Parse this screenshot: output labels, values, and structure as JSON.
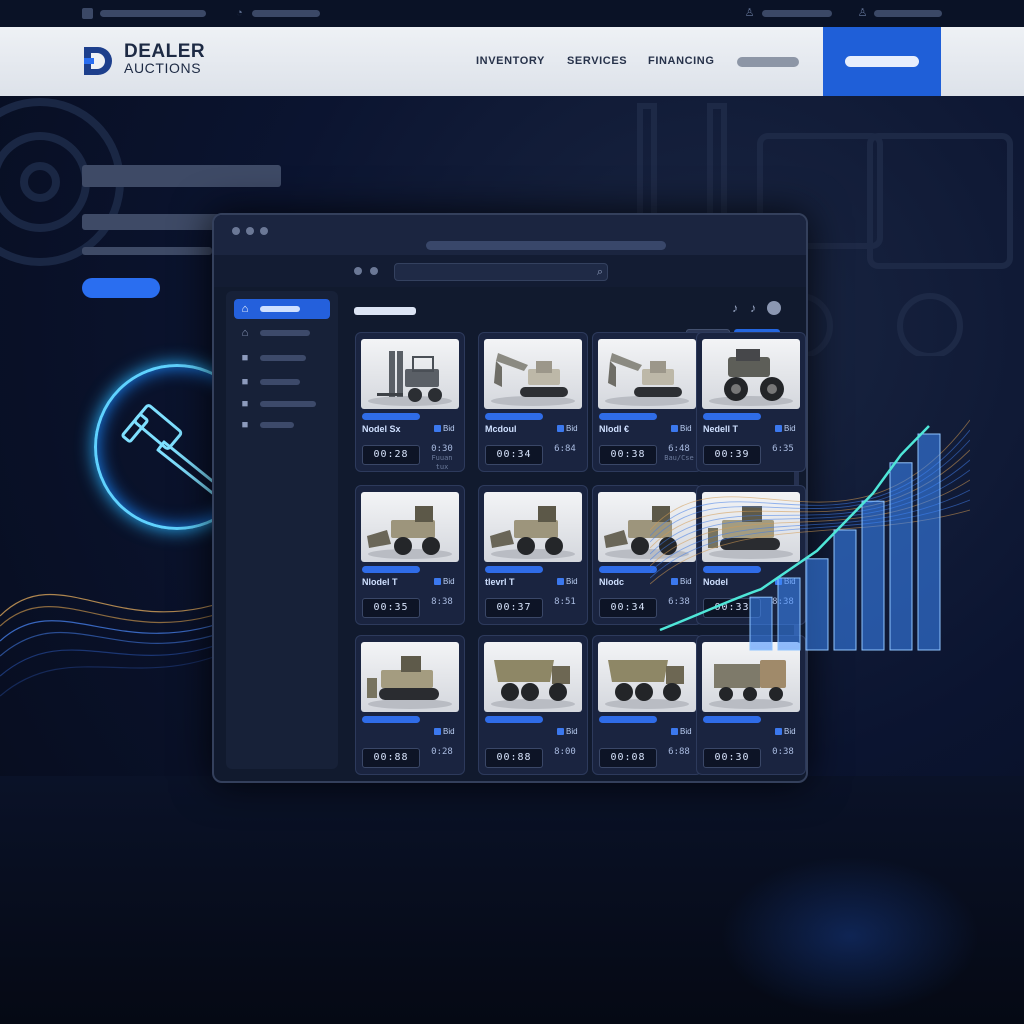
{
  "brand": {
    "name_line1": "DEALER",
    "name_line2": "AUCTIONS",
    "mark_color": "#1d3f8c",
    "accent": "#2a6ef0"
  },
  "utility_bar": {
    "icons": [
      "clock-icon",
      "user-icon",
      "person-icon"
    ]
  },
  "nav": {
    "links": [
      "INVENTORY",
      "SERVICES",
      "FINANCING"
    ]
  },
  "hero": {
    "icon": "gavel-icon"
  },
  "window": {
    "search_icon": "search-icon",
    "sidebar_icons": [
      "home-icon",
      "home-icon",
      "grid-icon",
      "grid-icon",
      "grid-icon",
      "grid-icon"
    ],
    "header_icons": [
      "bell-icon",
      "bell-icon",
      "avatar"
    ]
  },
  "listings": [
    {
      "name": "Nodel Sx",
      "bid": "Bid",
      "timer": "00:28",
      "price": "0:30",
      "price_sub": "Fuuan tux",
      "machine": "forklift"
    },
    {
      "name": "Mcdoul",
      "bid": "Bid",
      "timer": "00:34",
      "price": "6:84",
      "price_sub": "",
      "machine": "excavator"
    },
    {
      "name": "Nlodl €",
      "bid": "Bid",
      "timer": "00:38",
      "price": "6:48",
      "price_sub": "Bau/Cse",
      "machine": "excavator"
    },
    {
      "name": "Nedell T",
      "bid": "Bid",
      "timer": "00:39",
      "price": "6:35",
      "price_sub": "",
      "machine": "tractor"
    },
    {
      "name": "Nlodel T",
      "bid": "Bid",
      "timer": "00:35",
      "price": "8:38",
      "price_sub": "",
      "machine": "wheel-loader"
    },
    {
      "name": "tlevrl T",
      "bid": "Bid",
      "timer": "00:37",
      "price": "8:51",
      "price_sub": "",
      "machine": "wheel-loader"
    },
    {
      "name": "Nlodc",
      "bid": "Bid",
      "timer": "00:34",
      "price": "6:38",
      "price_sub": "",
      "machine": "wheel-loader"
    },
    {
      "name": "Nodel",
      "bid": "Bid",
      "timer": "00:33",
      "price": "8:38",
      "price_sub": "",
      "machine": "bulldozer"
    },
    {
      "name": "",
      "bid": "Bid",
      "timer": "00:88",
      "price": "0:28",
      "price_sub": "",
      "machine": "bulldozer"
    },
    {
      "name": "",
      "bid": "Bid",
      "timer": "00:88",
      "price": "8:00",
      "price_sub": "",
      "machine": "dump-truck"
    },
    {
      "name": "",
      "bid": "Bid",
      "timer": "00:08",
      "price": "6:88",
      "price_sub": "",
      "machine": "dump-truck"
    },
    {
      "name": "",
      "bid": "Bid",
      "timer": "00:30",
      "price": "0:38",
      "price_sub": "",
      "machine": "truck"
    }
  ],
  "growth_chart": {
    "bar_levels": [
      0.22,
      0.3,
      0.38,
      0.5,
      0.62,
      0.78,
      0.9
    ],
    "line_color": "#4fe6d8",
    "bar_color": "#3d8bff"
  }
}
